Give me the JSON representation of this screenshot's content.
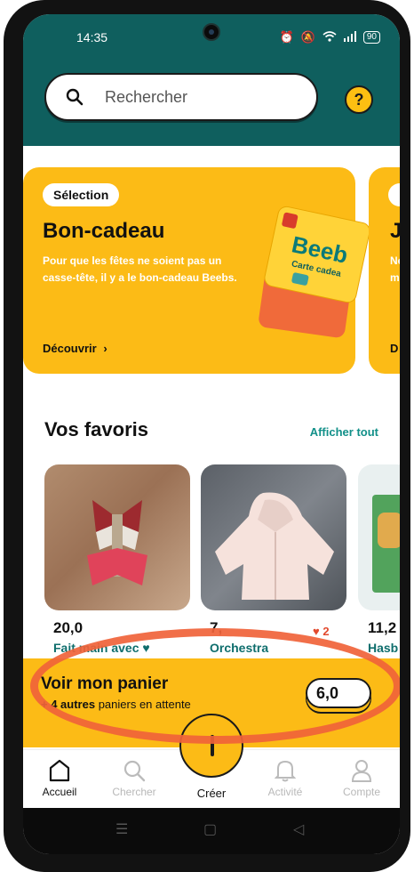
{
  "status_bar": {
    "time": "14:35",
    "battery": "90"
  },
  "search": {
    "placeholder": "Rechercher"
  },
  "help": {
    "label": "?"
  },
  "banner": {
    "chip": "Sélection",
    "title": "Bon-cadeau",
    "description": "Pour que les fêtes ne soient pas un casse-tête, il y a le bon-cadeau Beebs.",
    "link": "Découvrir",
    "link_chevron": "›",
    "card_brand": "Beeb",
    "card_sub": "Carte cadea"
  },
  "next_banner": {
    "title": "J",
    "text_line1": "Ne",
    "text_line2": "m",
    "link": "D"
  },
  "favorites": {
    "title": "Vos favoris",
    "see_all": "Afficher tout",
    "items": [
      {
        "price": "20,0",
        "shop": "Fait main avec ♥"
      },
      {
        "price": "7,",
        "shop": "Orchestra",
        "likes": "2"
      },
      {
        "price": "11,2",
        "shop": "Hasb"
      }
    ]
  },
  "cart": {
    "title": "Voir mon panier",
    "subtitle_bold": "+ 4 autres",
    "subtitle_rest": "paniers en attente",
    "price": "6,0"
  },
  "tabs": {
    "home": "Accueil",
    "search": "Chercher",
    "create": "Créer",
    "activity": "Activité",
    "account": "Compte"
  },
  "colors": {
    "teal": "#0f5f5e",
    "yellow": "#fcbb16",
    "link_teal": "#129089",
    "annotation": "#f0633a"
  }
}
